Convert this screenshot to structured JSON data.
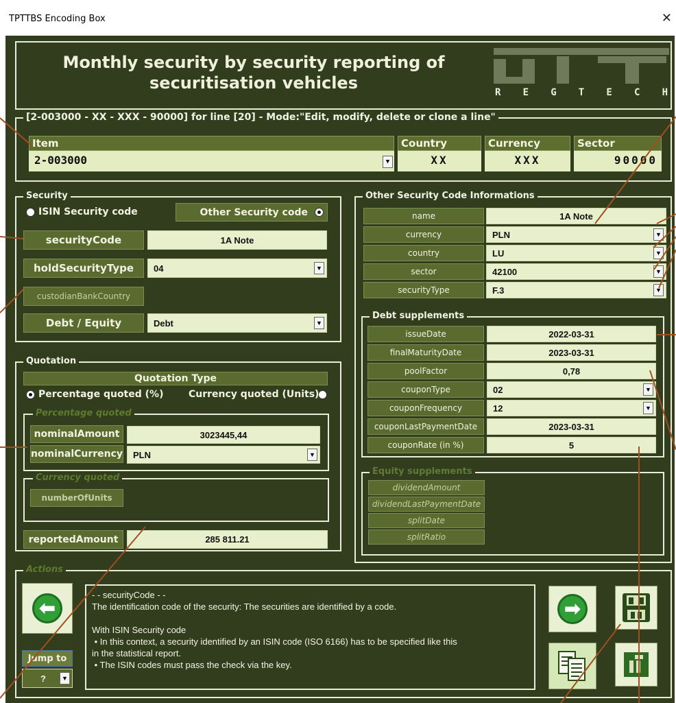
{
  "window": {
    "title": "TPTTBS Encoding Box",
    "close_glyph": "✕"
  },
  "header": {
    "title_line1": "Monthly security by security reporting of",
    "title_line2": "securitisation vehicles",
    "logo_letters": [
      "R",
      "E",
      "G",
      "T",
      "E",
      "C",
      "H"
    ]
  },
  "item_frame": {
    "legend": "[2-003000 - XX - XXX - 90000] for line [20] - Mode:\"Edit, modify, delete or clone a line\"",
    "headers": {
      "item": "Item",
      "country": "Country",
      "currency": "Currency",
      "sector": "Sector"
    },
    "values": {
      "item": "2-003000",
      "country": "XX",
      "currency": "XXX",
      "sector": "90000"
    }
  },
  "security": {
    "legend": "Security",
    "isin_label": "ISIN Security code",
    "other_label": "Other Security code",
    "selected": "other",
    "fields": [
      {
        "label": "securityCode",
        "value": "1A Note",
        "dropdown": false
      },
      {
        "label": "holdSecurityType",
        "value": "04",
        "dropdown": true
      },
      {
        "label": "custodianBankCountry",
        "value": "",
        "dropdown": false
      },
      {
        "label": "Debt / Equity",
        "value": "Debt",
        "dropdown": true
      }
    ]
  },
  "quotation": {
    "legend": "Quotation",
    "type_header": "Quotation Type",
    "percentage_label": "Percentage quoted  (%)",
    "currency_label": "Currency quoted  (Units)",
    "selected": "percentage",
    "pct_legend": "Percentage quoted",
    "cur_legend": "Currency quoted",
    "nominal_amount_label": "nominalAmount",
    "nominal_amount_value": "3023445,44",
    "nominal_currency_label": "nominalCurrency",
    "nominal_currency_value": "PLN",
    "units_label": "numberOfUnits",
    "reported_label": "reportedAmount",
    "reported_value": "285 811.21"
  },
  "other_codes": {
    "legend": "Other Security Code Informations",
    "fields": [
      {
        "label": "name",
        "value": "1A Note",
        "dropdown": false
      },
      {
        "label": "currency",
        "value": "PLN",
        "dropdown": true
      },
      {
        "label": "country",
        "value": "LU",
        "dropdown": true
      },
      {
        "label": "sector",
        "value": "42100",
        "dropdown": true
      },
      {
        "label": "securityType",
        "value": "F.3",
        "dropdown": true
      }
    ]
  },
  "debt": {
    "legend": "Debt supplements",
    "fields": [
      {
        "label": "issueDate",
        "value": "2022-03-31",
        "dropdown": false
      },
      {
        "label": "finalMaturityDate",
        "value": "2023-03-31",
        "dropdown": false
      },
      {
        "label": "poolFactor",
        "value": "0,78",
        "dropdown": false
      },
      {
        "label": "couponType",
        "value": "02",
        "dropdown": true
      },
      {
        "label": "couponFrequency",
        "value": "12",
        "dropdown": true
      },
      {
        "label": "couponLastPaymentDate",
        "value": "2023-03-31",
        "dropdown": false
      },
      {
        "label": "couponRate (in %)",
        "value": "5",
        "dropdown": false
      }
    ]
  },
  "equity": {
    "legend": "Equity supplements",
    "fields": [
      "dividendAmount",
      "dividendLastPaymentDate",
      "splitDate",
      "splitRatio"
    ]
  },
  "actions": {
    "legend": "Actions",
    "jump_label": "Jump to",
    "jump_value": "?",
    "help_lines": [
      "- - securityCode - -",
      "The identification code of the security: The securities are identified by a code.",
      "",
      "With ISIN Security code",
      " • In this context, a security identified by an ISIN code (ISO 6166) has to be specified like this",
      "in the statistical report.",
      " • The ISIN codes must pass the check via the key."
    ]
  },
  "icons": [
    "left-arrow-icon",
    "right-arrow-icon",
    "save-icon",
    "copy-icon",
    "delete-icon",
    "dropdown-arrow-icon"
  ],
  "colors": {
    "background": "#323d1e",
    "label": "#5a6b30",
    "input": "#e8efcd",
    "annotation": "#a0501e",
    "button_green": "#2f9f36"
  }
}
